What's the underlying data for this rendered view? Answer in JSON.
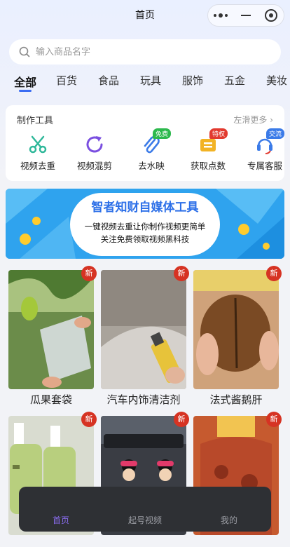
{
  "header": {
    "title": "首页"
  },
  "search": {
    "placeholder": "输入商品名字",
    "value": ""
  },
  "categories": [
    "全部",
    "百货",
    "食品",
    "玩具",
    "服饰",
    "五金",
    "美妆"
  ],
  "tools": {
    "title": "制作工具",
    "more": "左滑更多",
    "items": [
      {
        "label": "视频去重",
        "icon": "scissors-icon",
        "color": "#2fb89a"
      },
      {
        "label": "视频混剪",
        "icon": "refresh-icon",
        "color": "#7a4fe0"
      },
      {
        "label": "去水映",
        "icon": "paperclip-icon",
        "color": "#3b7be8",
        "tag": "免费",
        "tag_color": "#2db94d"
      },
      {
        "label": "获取点数",
        "icon": "coins-icon",
        "color": "#f2b325",
        "tag": "特权",
        "tag_color": "#e23a2f"
      },
      {
        "label": "专属客服",
        "icon": "headset-icon",
        "color": "#3b7be8",
        "tag": "交流",
        "tag_color": "#3b7be8"
      }
    ]
  },
  "banner": {
    "title": "智者知财自媒体工具",
    "line1": "一键视频去重让你制作视频更简单",
    "line2": "关注免费领取视频黑科技"
  },
  "products": [
    {
      "name": "瓜果套袋",
      "badge": "新"
    },
    {
      "name": "汽车内饰清洁剂",
      "badge": "新"
    },
    {
      "name": "法式酱鹅肝",
      "badge": "新"
    },
    {
      "name": "",
      "badge": "新"
    },
    {
      "name": "",
      "badge": "新"
    },
    {
      "name": "",
      "badge": "新"
    }
  ],
  "tabbar": [
    {
      "label": "首页",
      "active": true
    },
    {
      "label": "起号视频",
      "active": false
    },
    {
      "label": "我的",
      "active": false
    }
  ],
  "colors": {
    "accent": "#3b6df2",
    "tab_active": "#8a6cf0",
    "badge": "#d63323"
  }
}
